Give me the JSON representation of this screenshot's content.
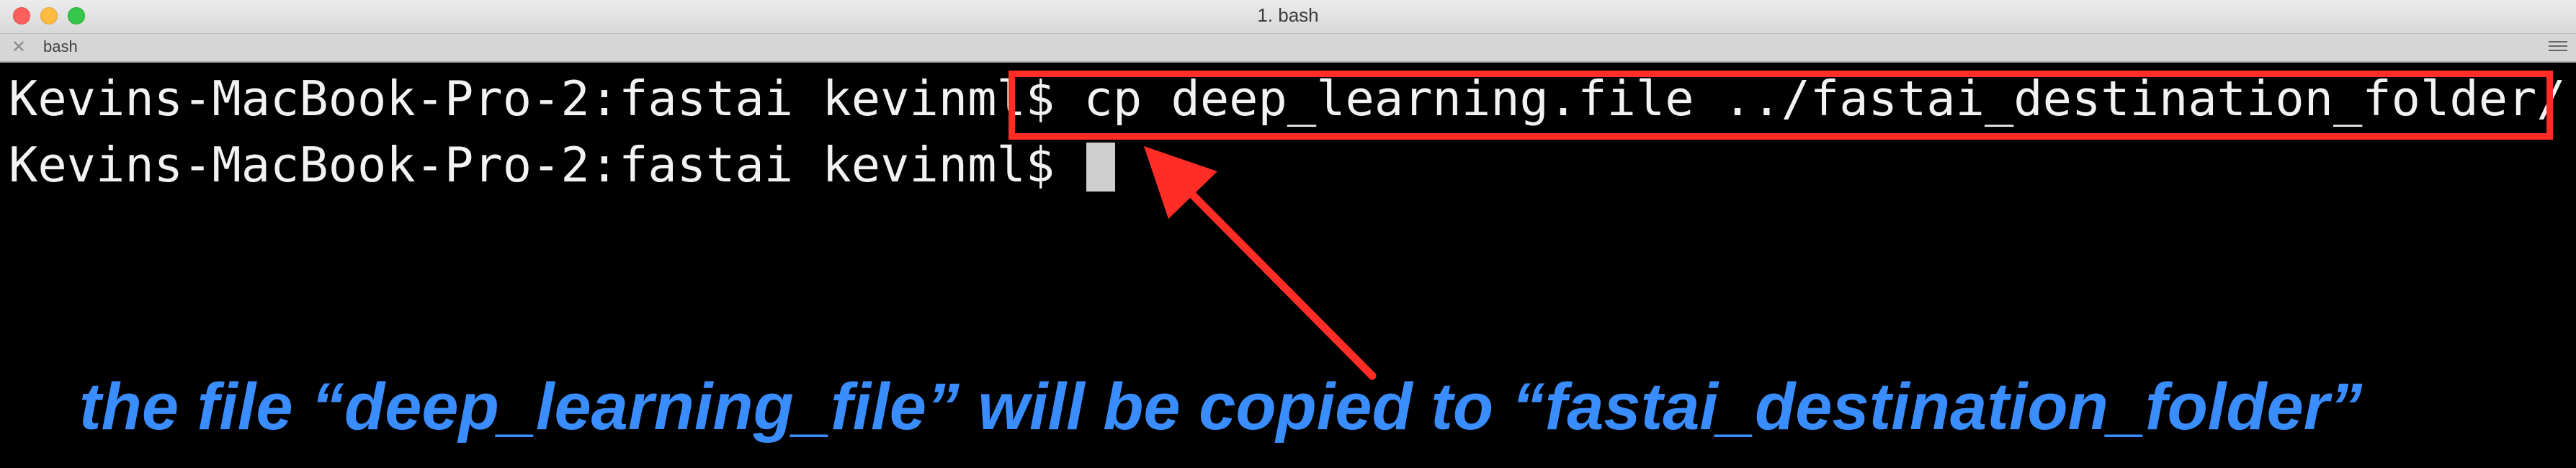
{
  "window": {
    "title": "1. bash",
    "tab_label": "bash",
    "tab_close_icon": "close-icon",
    "menu_icon": "hamburger-menu-icon"
  },
  "terminal": {
    "line1_prompt": "Kevins-MacBook-Pro-2:fastai kevinml$",
    "line1_command": " cp deep_learning.file ../fastai_destination_folder/",
    "line2_prompt": "Kevins-MacBook-Pro-2:fastai kevinml$ "
  },
  "annotation": {
    "caption": "the file “deep_learning_file” will be copied to “fastai_destination_folder”",
    "highlight_color": "#ff2d26",
    "caption_color": "#3a8dff"
  },
  "colors": {
    "background": "#000000",
    "text": "#f2f2f2",
    "close": "#fc605c",
    "minimize": "#fdbc40",
    "maximize": "#34c749"
  }
}
